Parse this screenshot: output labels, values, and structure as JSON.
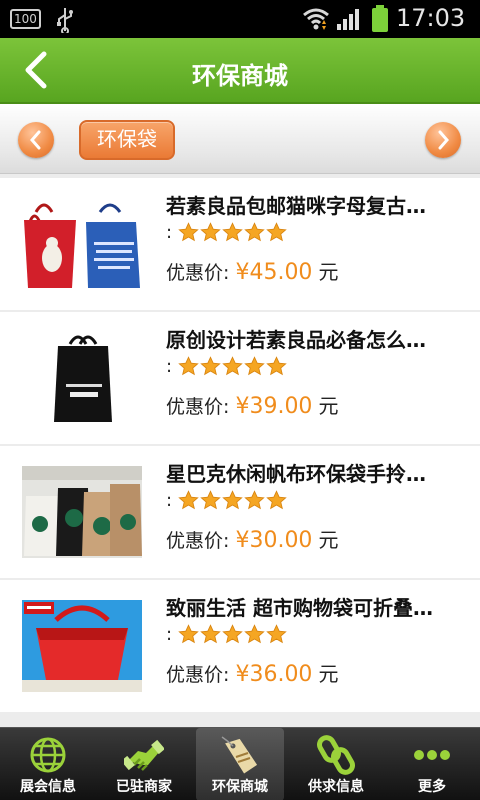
{
  "status_bar": {
    "battery_percent": "100",
    "time": "17:03"
  },
  "header": {
    "title": "环保商城"
  },
  "category_bar": {
    "current_category": "环保袋"
  },
  "products": [
    {
      "name": "若素良品包邮猫咪字母复古…",
      "rating_prefix": ":",
      "stars": 5,
      "price_label": "优惠价:",
      "price": "¥45.00",
      "unit": "元"
    },
    {
      "name": "原创设计若素良品必备怎么…",
      "rating_prefix": ":",
      "stars": 5,
      "price_label": "优惠价:",
      "price": "¥39.00",
      "unit": "元"
    },
    {
      "name": "星巴克休闲帆布环保袋手拎…",
      "rating_prefix": ":",
      "stars": 5,
      "price_label": "优惠价:",
      "price": "¥30.00",
      "unit": "元"
    },
    {
      "name": "致丽生活 超市购物袋可折叠…",
      "rating_prefix": ":",
      "stars": 5,
      "price_label": "优惠价:",
      "price": "¥36.00",
      "unit": "元"
    }
  ],
  "tabs": [
    {
      "label": "展会信息",
      "icon": "globe-icon"
    },
    {
      "label": "已驻商家",
      "icon": "handshake-icon"
    },
    {
      "label": "环保商城",
      "icon": "sale-tag-icon",
      "active": true
    },
    {
      "label": "供求信息",
      "icon": "chain-link-icon"
    },
    {
      "label": "更多",
      "icon": "more-dots-icon"
    }
  ],
  "colors": {
    "header_green": "#6bb62d",
    "price_orange": "#f08c1c",
    "star_orange": "#f5a623",
    "chip_orange": "#ea7a35"
  }
}
